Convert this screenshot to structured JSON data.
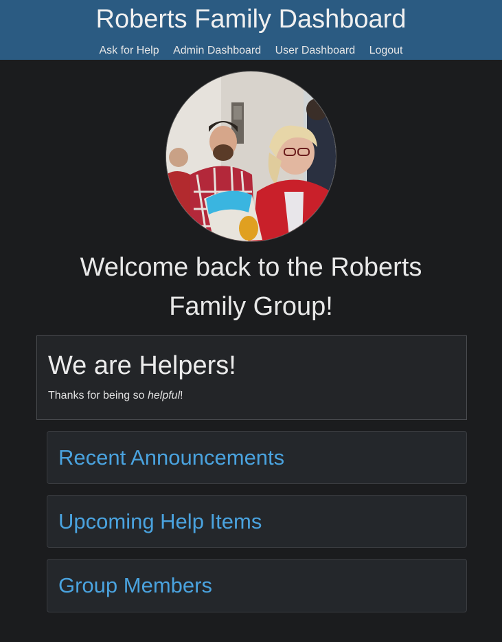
{
  "header": {
    "title": "Roberts Family Dashboard",
    "nav": [
      "Ask for Help",
      "Admin Dashboard",
      "User Dashboard",
      "Logout"
    ]
  },
  "welcome": "Welcome back to the Roberts Family Group!",
  "helpers": {
    "heading": "We are Helpers!",
    "text_before": "Thanks for being so ",
    "text_em": "helpful",
    "text_after": "!"
  },
  "cards": [
    "Recent Announcements",
    "Upcoming Help Items",
    "Group Members"
  ],
  "colors": {
    "header_bg": "#2b5b82",
    "page_bg": "#1b1c1e",
    "link": "#4aa3df"
  }
}
